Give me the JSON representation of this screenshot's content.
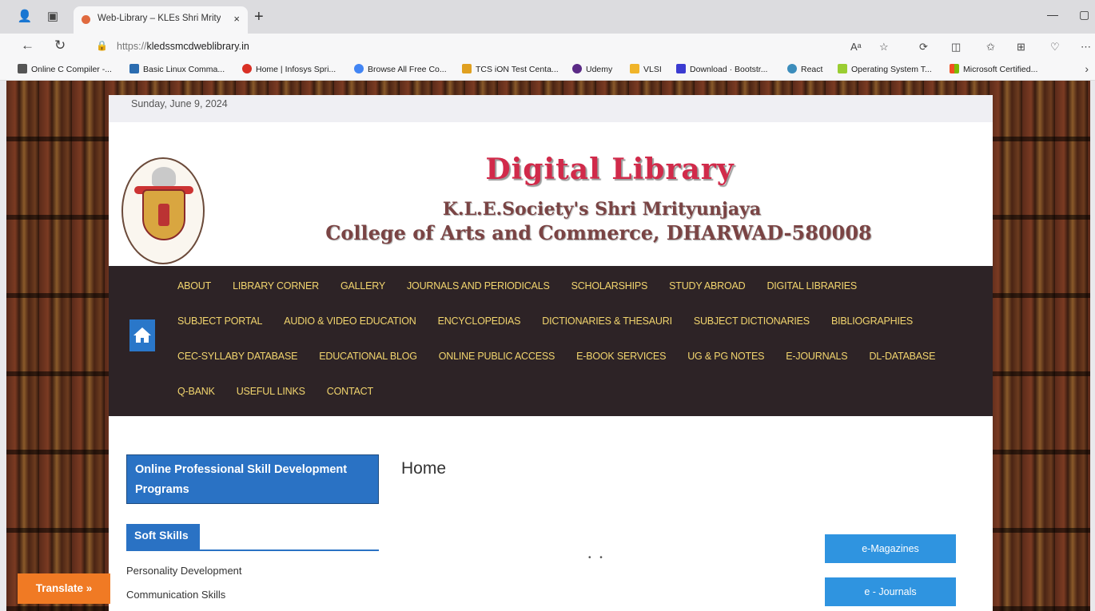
{
  "browser": {
    "tab_title": "Web-Library – KLEs Shri Mrityun",
    "tab_close": "×",
    "new_tab": "+",
    "url_scheme": "https://",
    "url_host": "kledssmcdweblibrary.in",
    "bookmarks": [
      {
        "label": "Online C Compiler -...",
        "color": "#555555"
      },
      {
        "label": "Basic Linux Comma...",
        "color": "#2b6cb0"
      },
      {
        "label": "Home | Infosys Spri...",
        "color": "#d93025"
      },
      {
        "label": "Browse All Free Co...",
        "color": "#4285f4"
      },
      {
        "label": "TCS iON Test Centa...",
        "color": "#e0a020"
      },
      {
        "label": "Udemy",
        "color": "#5b2a86"
      },
      {
        "label": "VLSI",
        "color": "#f0b429"
      },
      {
        "label": "Download · Bootstr...",
        "color": "#3b3bd1"
      },
      {
        "label": "React",
        "color": "#3c8dbc"
      },
      {
        "label": "Operating System T...",
        "color": "#9acd32"
      },
      {
        "label": "Microsoft Certified...",
        "color": "#f25022"
      }
    ]
  },
  "page": {
    "date": "Sunday, June 9, 2024",
    "title_main": "Digital Library",
    "title_sub": "K.L.E.Society's Shri Mrityunjaya",
    "title_college": "College of Arts and Commerce, DHARWAD-580008",
    "nav_rows": [
      [
        "ABOUT",
        "LIBRARY CORNER",
        "GALLERY",
        "JOURNALS AND PERIODICALS",
        "SCHOLARSHIPS",
        "STUDY ABROAD",
        "DIGITAL LIBRARIES"
      ],
      [
        "SUBJECT PORTAL",
        "AUDIO & VIDEO EDUCATION",
        "ENCYCLOPEDIAS",
        "DICTIONARIES & THESAURI",
        "SUBJECT DICTIONARIES",
        "BIBLIOGRAPHIES"
      ],
      [
        "CEC-SYLLABY DATABASE",
        "EDUCATIONAL BLOG",
        "ONLINE PUBLIC ACCESS",
        "E-BOOK SERVICES",
        "UG & PG NOTES",
        "E-JOURNALS",
        "DL-DATABASE"
      ],
      [
        "Q-BANK",
        "USEFUL LINKS",
        "CONTACT"
      ]
    ],
    "promo": "Online Professional Skill Development Programs",
    "heading": "Home",
    "soft_skills_tab": "Soft Skills",
    "soft_skill_links": [
      "Personality Development",
      "Communication Skills"
    ],
    "btn_magazines": "e-Magazines",
    "btn_journals": "e - Journals",
    "translate": "Translate »"
  }
}
